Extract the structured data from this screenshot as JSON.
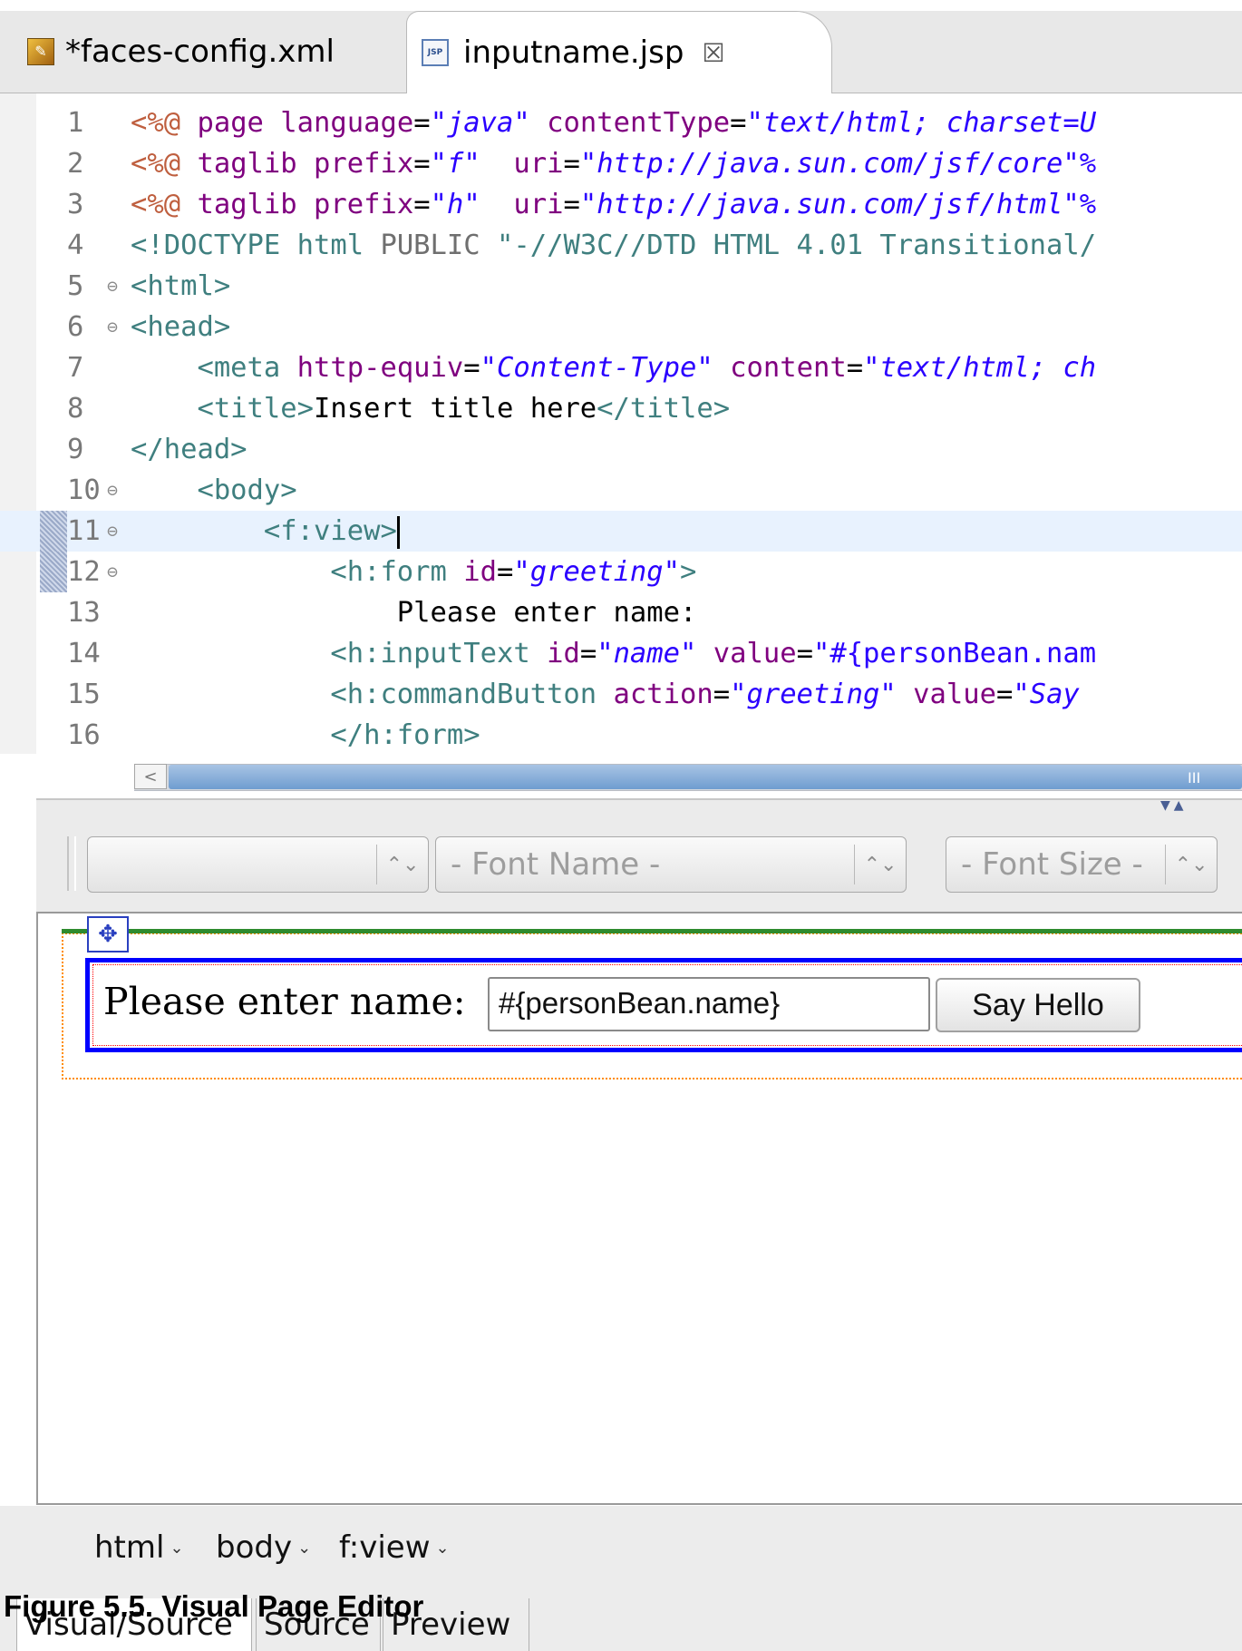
{
  "tabs": [
    {
      "label": "*faces-config.xml",
      "icon": "xml-file-icon",
      "active": false
    },
    {
      "label": "inputname.jsp",
      "icon": "jsp-file-icon",
      "active": true,
      "close": "☒"
    }
  ],
  "editor": {
    "current_line": 11,
    "lines": [
      {
        "n": "1",
        "fold": "",
        "parts": [
          [
            "k-dir",
            "<%@"
          ],
          [
            "k-txt",
            " "
          ],
          [
            "k-attr",
            "page language"
          ],
          [
            "k-txt",
            "="
          ],
          [
            "k-str2",
            "\""
          ],
          [
            "k-str",
            "java"
          ],
          [
            "k-str2",
            "\""
          ],
          [
            "k-txt",
            " "
          ],
          [
            "k-attr",
            "contentType"
          ],
          [
            "k-txt",
            "="
          ],
          [
            "k-str2",
            "\""
          ],
          [
            "k-str",
            "text/html; charset=U"
          ]
        ]
      },
      {
        "n": "2",
        "fold": "",
        "parts": [
          [
            "k-dir",
            "<%@"
          ],
          [
            "k-txt",
            " "
          ],
          [
            "k-attr",
            "taglib prefix"
          ],
          [
            "k-txt",
            "="
          ],
          [
            "k-str2",
            "\""
          ],
          [
            "k-str",
            "f"
          ],
          [
            "k-str2",
            "\""
          ],
          [
            "k-txt",
            "  "
          ],
          [
            "k-attr",
            "uri"
          ],
          [
            "k-txt",
            "="
          ],
          [
            "k-str2",
            "\""
          ],
          [
            "k-str",
            "http://java.sun.com/jsf/core"
          ],
          [
            "k-str2",
            "\"%"
          ]
        ]
      },
      {
        "n": "3",
        "fold": "",
        "parts": [
          [
            "k-dir",
            "<%@"
          ],
          [
            "k-txt",
            " "
          ],
          [
            "k-attr",
            "taglib prefix"
          ],
          [
            "k-txt",
            "="
          ],
          [
            "k-str2",
            "\""
          ],
          [
            "k-str",
            "h"
          ],
          [
            "k-str2",
            "\""
          ],
          [
            "k-txt",
            "  "
          ],
          [
            "k-attr",
            "uri"
          ],
          [
            "k-txt",
            "="
          ],
          [
            "k-str2",
            "\""
          ],
          [
            "k-str",
            "http://java.sun.com/jsf/html"
          ],
          [
            "k-str2",
            "\"%"
          ]
        ]
      },
      {
        "n": "4",
        "fold": "",
        "parts": [
          [
            "k-tag",
            "<!DOCTYPE html "
          ],
          [
            "k-gray",
            "PUBLIC "
          ],
          [
            "k-tag",
            "\"-//W3C//DTD HTML 4.01 Transitional/"
          ]
        ]
      },
      {
        "n": "5",
        "fold": "⊖",
        "parts": [
          [
            "k-tag",
            "<html>"
          ]
        ]
      },
      {
        "n": "6",
        "fold": "⊖",
        "parts": [
          [
            "k-tag",
            "<head>"
          ]
        ]
      },
      {
        "n": "7",
        "fold": "",
        "parts": [
          [
            "k-txt",
            "    "
          ],
          [
            "k-tag",
            "<meta "
          ],
          [
            "k-attr",
            "http-equiv"
          ],
          [
            "k-txt",
            "="
          ],
          [
            "k-str2",
            "\""
          ],
          [
            "k-str",
            "Content-Type"
          ],
          [
            "k-str2",
            "\""
          ],
          [
            "k-txt",
            " "
          ],
          [
            "k-attr",
            "content"
          ],
          [
            "k-txt",
            "="
          ],
          [
            "k-str2",
            "\""
          ],
          [
            "k-str",
            "text/html; ch"
          ]
        ]
      },
      {
        "n": "8",
        "fold": "",
        "parts": [
          [
            "k-txt",
            "    "
          ],
          [
            "k-tag",
            "<title>"
          ],
          [
            "k-txt",
            "Insert title here"
          ],
          [
            "k-tag",
            "</title>"
          ]
        ]
      },
      {
        "n": "9",
        "fold": "",
        "parts": [
          [
            "k-tag",
            "</head>"
          ]
        ]
      },
      {
        "n": "10",
        "fold": "⊖",
        "parts": [
          [
            "k-txt",
            "    "
          ],
          [
            "k-tag",
            "<body>"
          ]
        ]
      },
      {
        "n": "11",
        "fold": "⊖",
        "parts": [
          [
            "k-txt",
            "        "
          ],
          [
            "k-tag",
            "<f:view>"
          ]
        ]
      },
      {
        "n": "12",
        "fold": "⊖",
        "parts": [
          [
            "k-txt",
            "            "
          ],
          [
            "k-tag",
            "<h:form "
          ],
          [
            "k-attr",
            "id"
          ],
          [
            "k-txt",
            "="
          ],
          [
            "k-str2",
            "\""
          ],
          [
            "k-str",
            "greeting"
          ],
          [
            "k-str2",
            "\""
          ],
          [
            "k-tag",
            ">"
          ]
        ]
      },
      {
        "n": "13",
        "fold": "",
        "parts": [
          [
            "k-txt",
            "                Please enter name:"
          ]
        ]
      },
      {
        "n": "14",
        "fold": "",
        "parts": [
          [
            "k-txt",
            "            "
          ],
          [
            "k-tag",
            "<h:inputText "
          ],
          [
            "k-attr",
            "id"
          ],
          [
            "k-txt",
            "="
          ],
          [
            "k-str2",
            "\""
          ],
          [
            "k-str",
            "name"
          ],
          [
            "k-str2",
            "\""
          ],
          [
            "k-txt",
            " "
          ],
          [
            "k-attr",
            "value"
          ],
          [
            "k-txt",
            "="
          ],
          [
            "k-str2",
            "\"#{personBean.nam"
          ]
        ]
      },
      {
        "n": "15",
        "fold": "",
        "parts": [
          [
            "k-txt",
            "            "
          ],
          [
            "k-tag",
            "<h:commandButton "
          ],
          [
            "k-attr",
            "action"
          ],
          [
            "k-txt",
            "="
          ],
          [
            "k-str2",
            "\""
          ],
          [
            "k-str",
            "greeting"
          ],
          [
            "k-str2",
            "\""
          ],
          [
            "k-txt",
            " "
          ],
          [
            "k-attr",
            "value"
          ],
          [
            "k-txt",
            "="
          ],
          [
            "k-str2",
            "\""
          ],
          [
            "k-str",
            "Say "
          ]
        ]
      },
      {
        "n": "16",
        "fold": "",
        "parts": [
          [
            "k-txt",
            "            "
          ],
          [
            "k-tag",
            "</h:form>"
          ]
        ]
      }
    ]
  },
  "scrollbar": {
    "left_arrow": "<",
    "grip": "III"
  },
  "splitter": {
    "arrows": "▼▲"
  },
  "toolbar": {
    "format_placeholder": "",
    "font_name_placeholder": "- Font Name -",
    "font_size_placeholder": "- Font Size -",
    "arrows": "⌃⌄"
  },
  "visual": {
    "move_handle": "✥",
    "prompt": "Please enter name:",
    "input_value": "#{personBean.name}",
    "button_label": "Say Hello"
  },
  "breadcrumb": [
    {
      "label": "html",
      "chev": "⌄"
    },
    {
      "label": "body",
      "chev": "⌄"
    },
    {
      "label": "f:view",
      "chev": "⌄"
    }
  ],
  "bottom_tabs": [
    "Visual/Source",
    "Source",
    "Preview"
  ],
  "caption": "Figure 5.5. Visual Page Editor"
}
